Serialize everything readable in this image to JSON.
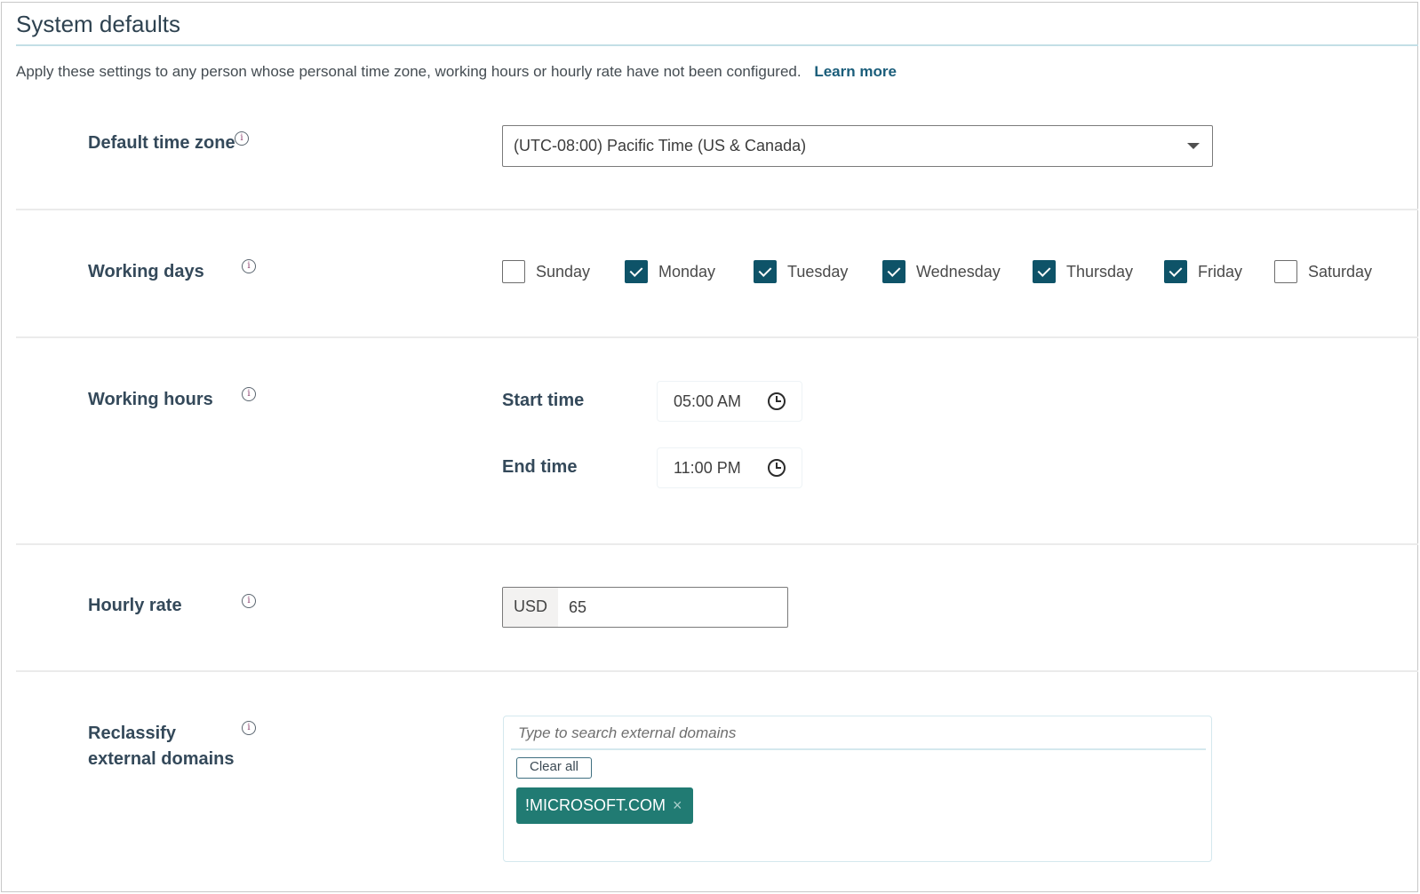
{
  "header": {
    "title": "System defaults",
    "description": "Apply these settings to any person whose personal time zone, working hours or hourly rate have not been configured.",
    "learn_more": "Learn more"
  },
  "info_glyph": "i",
  "time_zone": {
    "label": "Default time zone",
    "selected": "(UTC-08:00) Pacific Time (US & Canada)"
  },
  "working_days": {
    "label": "Working days",
    "days": [
      {
        "label": "Sunday",
        "checked": false
      },
      {
        "label": "Monday",
        "checked": true
      },
      {
        "label": "Tuesday",
        "checked": true
      },
      {
        "label": "Wednesday",
        "checked": true
      },
      {
        "label": "Thursday",
        "checked": true
      },
      {
        "label": "Friday",
        "checked": true
      },
      {
        "label": "Saturday",
        "checked": false
      }
    ]
  },
  "working_hours": {
    "label": "Working hours",
    "start_label": "Start time",
    "start_value": "05:00 AM",
    "end_label": "End time",
    "end_value": "11:00 PM"
  },
  "hourly_rate": {
    "label": "Hourly rate",
    "currency": "USD",
    "value": "65"
  },
  "domains": {
    "label_line1": "Reclassify",
    "label_line2": "external domains",
    "search_placeholder": "Type to search external domains",
    "clear_all": "Clear all",
    "tags": [
      {
        "label": "!MICROSOFT.COM",
        "remove_glyph": "×"
      }
    ]
  },
  "colors": {
    "accent": "#0e5368",
    "link": "#1a5d7a",
    "tag_bg": "#217b73",
    "header_rule": "#c3dfe6"
  }
}
